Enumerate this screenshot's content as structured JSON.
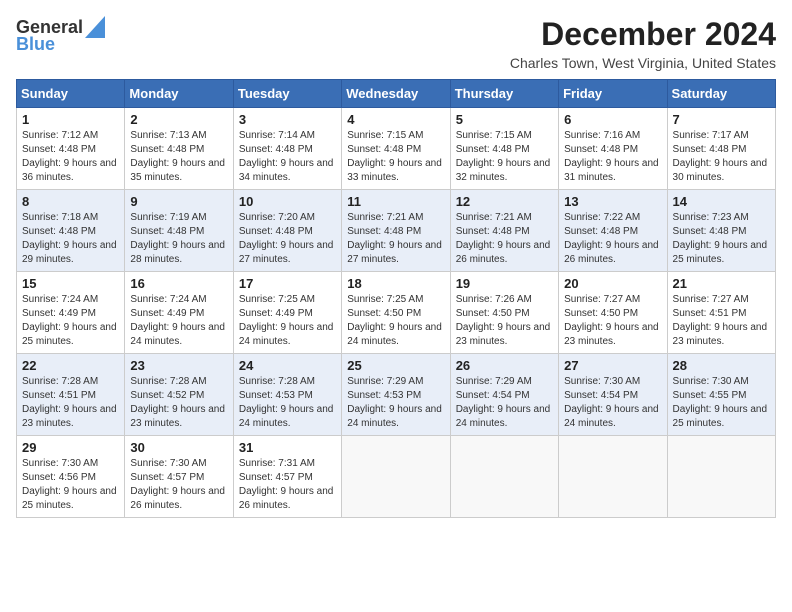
{
  "header": {
    "logo_line1": "General",
    "logo_line2": "Blue",
    "month": "December 2024",
    "location": "Charles Town, West Virginia, United States"
  },
  "days_of_week": [
    "Sunday",
    "Monday",
    "Tuesday",
    "Wednesday",
    "Thursday",
    "Friday",
    "Saturday"
  ],
  "weeks": [
    [
      {
        "day": "1",
        "sunrise": "7:12 AM",
        "sunset": "4:48 PM",
        "daylight": "9 hours and 36 minutes."
      },
      {
        "day": "2",
        "sunrise": "7:13 AM",
        "sunset": "4:48 PM",
        "daylight": "9 hours and 35 minutes."
      },
      {
        "day": "3",
        "sunrise": "7:14 AM",
        "sunset": "4:48 PM",
        "daylight": "9 hours and 34 minutes."
      },
      {
        "day": "4",
        "sunrise": "7:15 AM",
        "sunset": "4:48 PM",
        "daylight": "9 hours and 33 minutes."
      },
      {
        "day": "5",
        "sunrise": "7:15 AM",
        "sunset": "4:48 PM",
        "daylight": "9 hours and 32 minutes."
      },
      {
        "day": "6",
        "sunrise": "7:16 AM",
        "sunset": "4:48 PM",
        "daylight": "9 hours and 31 minutes."
      },
      {
        "day": "7",
        "sunrise": "7:17 AM",
        "sunset": "4:48 PM",
        "daylight": "9 hours and 30 minutes."
      }
    ],
    [
      {
        "day": "8",
        "sunrise": "7:18 AM",
        "sunset": "4:48 PM",
        "daylight": "9 hours and 29 minutes."
      },
      {
        "day": "9",
        "sunrise": "7:19 AM",
        "sunset": "4:48 PM",
        "daylight": "9 hours and 28 minutes."
      },
      {
        "day": "10",
        "sunrise": "7:20 AM",
        "sunset": "4:48 PM",
        "daylight": "9 hours and 27 minutes."
      },
      {
        "day": "11",
        "sunrise": "7:21 AM",
        "sunset": "4:48 PM",
        "daylight": "9 hours and 27 minutes."
      },
      {
        "day": "12",
        "sunrise": "7:21 AM",
        "sunset": "4:48 PM",
        "daylight": "9 hours and 26 minutes."
      },
      {
        "day": "13",
        "sunrise": "7:22 AM",
        "sunset": "4:48 PM",
        "daylight": "9 hours and 26 minutes."
      },
      {
        "day": "14",
        "sunrise": "7:23 AM",
        "sunset": "4:48 PM",
        "daylight": "9 hours and 25 minutes."
      }
    ],
    [
      {
        "day": "15",
        "sunrise": "7:24 AM",
        "sunset": "4:49 PM",
        "daylight": "9 hours and 25 minutes."
      },
      {
        "day": "16",
        "sunrise": "7:24 AM",
        "sunset": "4:49 PM",
        "daylight": "9 hours and 24 minutes."
      },
      {
        "day": "17",
        "sunrise": "7:25 AM",
        "sunset": "4:49 PM",
        "daylight": "9 hours and 24 minutes."
      },
      {
        "day": "18",
        "sunrise": "7:25 AM",
        "sunset": "4:50 PM",
        "daylight": "9 hours and 24 minutes."
      },
      {
        "day": "19",
        "sunrise": "7:26 AM",
        "sunset": "4:50 PM",
        "daylight": "9 hours and 23 minutes."
      },
      {
        "day": "20",
        "sunrise": "7:27 AM",
        "sunset": "4:50 PM",
        "daylight": "9 hours and 23 minutes."
      },
      {
        "day": "21",
        "sunrise": "7:27 AM",
        "sunset": "4:51 PM",
        "daylight": "9 hours and 23 minutes."
      }
    ],
    [
      {
        "day": "22",
        "sunrise": "7:28 AM",
        "sunset": "4:51 PM",
        "daylight": "9 hours and 23 minutes."
      },
      {
        "day": "23",
        "sunrise": "7:28 AM",
        "sunset": "4:52 PM",
        "daylight": "9 hours and 23 minutes."
      },
      {
        "day": "24",
        "sunrise": "7:28 AM",
        "sunset": "4:53 PM",
        "daylight": "9 hours and 24 minutes."
      },
      {
        "day": "25",
        "sunrise": "7:29 AM",
        "sunset": "4:53 PM",
        "daylight": "9 hours and 24 minutes."
      },
      {
        "day": "26",
        "sunrise": "7:29 AM",
        "sunset": "4:54 PM",
        "daylight": "9 hours and 24 minutes."
      },
      {
        "day": "27",
        "sunrise": "7:30 AM",
        "sunset": "4:54 PM",
        "daylight": "9 hours and 24 minutes."
      },
      {
        "day": "28",
        "sunrise": "7:30 AM",
        "sunset": "4:55 PM",
        "daylight": "9 hours and 25 minutes."
      }
    ],
    [
      {
        "day": "29",
        "sunrise": "7:30 AM",
        "sunset": "4:56 PM",
        "daylight": "9 hours and 25 minutes."
      },
      {
        "day": "30",
        "sunrise": "7:30 AM",
        "sunset": "4:57 PM",
        "daylight": "9 hours and 26 minutes."
      },
      {
        "day": "31",
        "sunrise": "7:31 AM",
        "sunset": "4:57 PM",
        "daylight": "9 hours and 26 minutes."
      },
      null,
      null,
      null,
      null
    ]
  ],
  "labels": {
    "sunrise": "Sunrise:",
    "sunset": "Sunset:",
    "daylight": "Daylight:"
  }
}
